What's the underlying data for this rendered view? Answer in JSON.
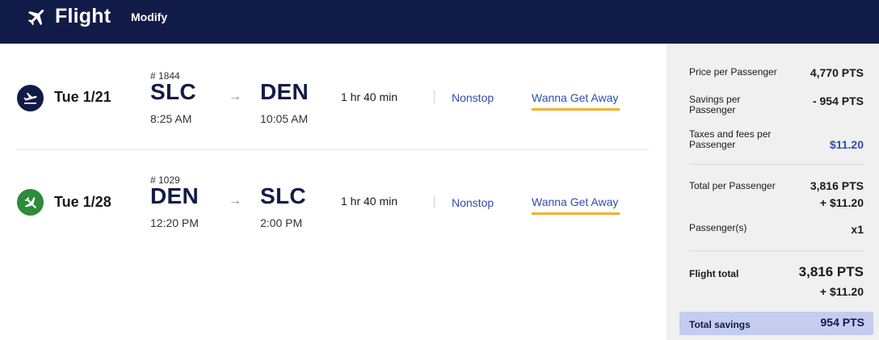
{
  "header": {
    "title": "Flight",
    "modify_label": "Modify",
    "icon": "airplane-icon",
    "background": "#111b47"
  },
  "flights": [
    {
      "icon": "departing-plane-icon",
      "icon_color": "#111b47",
      "date": "Tue 1/21",
      "flight_number": "# 1844",
      "origin": "SLC",
      "depart_time": "8:25 AM",
      "destination": "DEN",
      "arrive_time": "10:05 AM",
      "duration": "1 hr 40 min",
      "stops": "Nonstop",
      "fare_class": "Wanna Get Away"
    },
    {
      "icon": "returning-plane-icon",
      "icon_color": "#2f8a3a",
      "date": "Tue 1/28",
      "flight_number": "# 1029",
      "origin": "DEN",
      "depart_time": "12:20 PM",
      "destination": "SLC",
      "arrive_time": "2:00 PM",
      "duration": "1 hr 40 min",
      "stops": "Nonstop",
      "fare_class": "Wanna Get Away"
    }
  ],
  "summary": {
    "price_per_passenger_label": "Price per Passenger",
    "price_per_passenger_value": "4,770 PTS",
    "savings_per_passenger_label_line1": "Savings per",
    "savings_per_passenger_label_line2": "Passenger",
    "savings_per_passenger_value": "- 954 PTS",
    "taxes_label_line1": "Taxes and fees per",
    "taxes_label_line2": "Passenger",
    "taxes_value": "$11.20",
    "total_per_passenger_label": "Total per Passenger",
    "total_per_passenger_points": "3,816 PTS",
    "total_per_passenger_cash": "+ $11.20",
    "passengers_label": "Passenger(s)",
    "passengers_value": "x1",
    "flight_total_label": "Flight total",
    "flight_total_points": "3,816 PTS",
    "flight_total_cash": "+ $11.20",
    "total_savings_label": "Total savings",
    "total_savings_value": "954 PTS"
  },
  "colors": {
    "brand_navy": "#111b47",
    "link_blue": "#304cb2",
    "fare_underline": "#f4b02a",
    "savings_highlight": "#c4cdf0",
    "summary_background": "#f0f0f0"
  }
}
